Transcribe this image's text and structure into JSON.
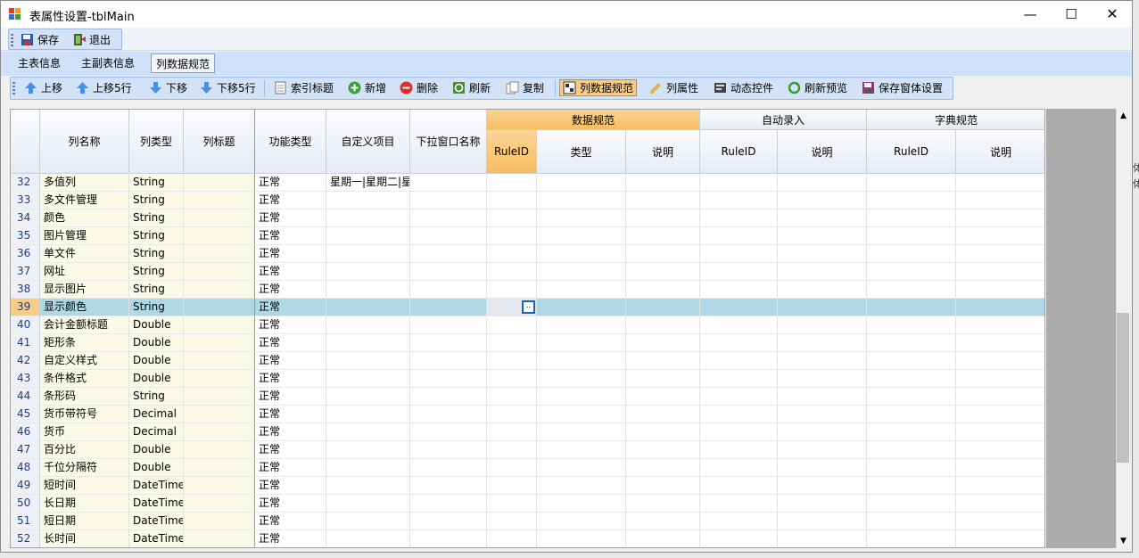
{
  "window": {
    "title": "表属性设置-tblMain",
    "min": "—",
    "max": "☐",
    "close": "✕"
  },
  "toolbar1": {
    "save": "保存",
    "exit": "退出"
  },
  "tabs": [
    "主表信息",
    "主副表信息",
    "列数据规范"
  ],
  "toolbar2": {
    "up": "上移",
    "up5": "上移5行",
    "down": "下移",
    "down5": "下移5行",
    "index_title": "索引标题",
    "add": "新增",
    "delete": "删除",
    "refresh": "刷新",
    "copy": "复制",
    "col_spec": "列数据规范",
    "col_attr": "列属性",
    "dynamic": "动态控件",
    "refresh_preview": "刷新预览",
    "save_form": "保存窗体设置"
  },
  "grid": {
    "group_headers": {
      "data_spec": "数据规范",
      "auto_entry": "自动录入",
      "dict_spec": "字典规范"
    },
    "headers": {
      "col_name": "列名称",
      "col_type": "列类型",
      "col_title": "列标题",
      "func_type": "功能类型",
      "custom_items": "自定义项目",
      "dropdown_name": "下拉窗口名称",
      "rule_id": "RuleID",
      "type": "类型",
      "desc": "说明"
    },
    "rows": [
      {
        "n": "32",
        "name": "多值列",
        "type": "String",
        "func": "正常",
        "custom": "星期一|星期二|星"
      },
      {
        "n": "33",
        "name": "多文件管理",
        "type": "String",
        "func": "正常",
        "custom": ""
      },
      {
        "n": "34",
        "name": "颜色",
        "type": "String",
        "func": "正常",
        "custom": ""
      },
      {
        "n": "35",
        "name": "图片管理",
        "type": "String",
        "func": "正常",
        "custom": ""
      },
      {
        "n": "36",
        "name": "单文件",
        "type": "String",
        "func": "正常",
        "custom": ""
      },
      {
        "n": "37",
        "name": "网址",
        "type": "String",
        "func": "正常",
        "custom": ""
      },
      {
        "n": "38",
        "name": "显示图片",
        "type": "String",
        "func": "正常",
        "custom": ""
      },
      {
        "n": "39",
        "name": "显示颜色",
        "type": "String",
        "func": "正常",
        "custom": ""
      },
      {
        "n": "40",
        "name": "会计金额标题",
        "type": "Double",
        "func": "正常",
        "custom": ""
      },
      {
        "n": "41",
        "name": "矩形条",
        "type": "Double",
        "func": "正常",
        "custom": ""
      },
      {
        "n": "42",
        "name": "自定义样式",
        "type": "Double",
        "func": "正常",
        "custom": ""
      },
      {
        "n": "43",
        "name": "条件格式",
        "type": "Double",
        "func": "正常",
        "custom": ""
      },
      {
        "n": "44",
        "name": "条形码",
        "type": "String",
        "func": "正常",
        "custom": ""
      },
      {
        "n": "45",
        "name": "货币带符号",
        "type": "Decimal",
        "func": "正常",
        "custom": ""
      },
      {
        "n": "46",
        "name": "货币",
        "type": "Decimal",
        "func": "正常",
        "custom": ""
      },
      {
        "n": "47",
        "name": "百分比",
        "type": "Double",
        "func": "正常",
        "custom": ""
      },
      {
        "n": "48",
        "name": "千位分隔符",
        "type": "Double",
        "func": "正常",
        "custom": ""
      },
      {
        "n": "49",
        "name": "短时间",
        "type": "DateTime",
        "func": "正常",
        "custom": ""
      },
      {
        "n": "50",
        "name": "长日期",
        "type": "DateTime",
        "func": "正常",
        "custom": ""
      },
      {
        "n": "51",
        "name": "短日期",
        "type": "DateTime",
        "func": "正常",
        "custom": ""
      },
      {
        "n": "52",
        "name": "长时间",
        "type": "DateTime",
        "func": "正常",
        "custom": ""
      }
    ],
    "selected_row": "39",
    "ellipsis_button": ".."
  },
  "outside_text": [
    "体",
    "体"
  ],
  "colors": {
    "accent_orange": "#f8cb86",
    "selection": "#add8e6",
    "title_col_bg": "#fafae6"
  }
}
